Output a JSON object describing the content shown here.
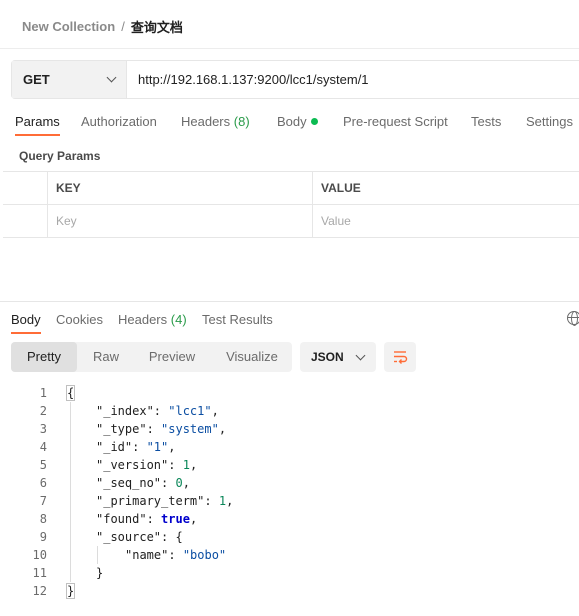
{
  "breadcrumb": {
    "parent": "New Collection",
    "separator": "/",
    "current": "查询文档"
  },
  "request": {
    "method": "GET",
    "url": "http://192.168.1.137:9200/lcc1/system/1"
  },
  "request_tabs": {
    "params": "Params",
    "authorization": "Authorization",
    "headers": "Headers",
    "headers_count": "(8)",
    "body": "Body",
    "prerequest": "Pre-request Script",
    "tests": "Tests",
    "settings": "Settings"
  },
  "query_params": {
    "title": "Query Params",
    "columns": {
      "key": "KEY",
      "value": "VALUE"
    },
    "placeholder": {
      "key": "Key",
      "value": "Value"
    }
  },
  "response_tabs": {
    "body": "Body",
    "cookies": "Cookies",
    "headers": "Headers",
    "headers_count": "(4)",
    "test_results": "Test Results"
  },
  "view_modes": {
    "pretty": "Pretty",
    "raw": "Raw",
    "preview": "Preview",
    "visualize": "Visualize",
    "active": "Pretty"
  },
  "format": "JSON",
  "response_json": {
    "open": "{",
    "index_key": "\"_index\"",
    "index_val": "\"lcc1\"",
    "type_key": "\"_type\"",
    "type_val": "\"system\"",
    "id_key": "\"_id\"",
    "id_val": "\"1\"",
    "version_key": "\"_version\"",
    "version_val": "1",
    "seq_key": "\"_seq_no\"",
    "seq_val": "0",
    "term_key": "\"_primary_term\"",
    "term_val": "1",
    "found_key": "\"found\"",
    "found_val": "true",
    "source_key": "\"_source\"",
    "source_open": "{",
    "name_key": "\"name\"",
    "name_val": "\"bobo\"",
    "source_close": "}",
    "close": "}"
  },
  "line_numbers": [
    "1",
    "2",
    "3",
    "4",
    "5",
    "6",
    "7",
    "8",
    "9",
    "10",
    "11",
    "12"
  ],
  "colors": {
    "accent": "#ff6c37",
    "status_dot": "#0cbb52",
    "count_text": "#2a9b4a",
    "json_string": "#0b4ea2",
    "json_number": "#098658",
    "json_boolean": "#0000cc"
  }
}
